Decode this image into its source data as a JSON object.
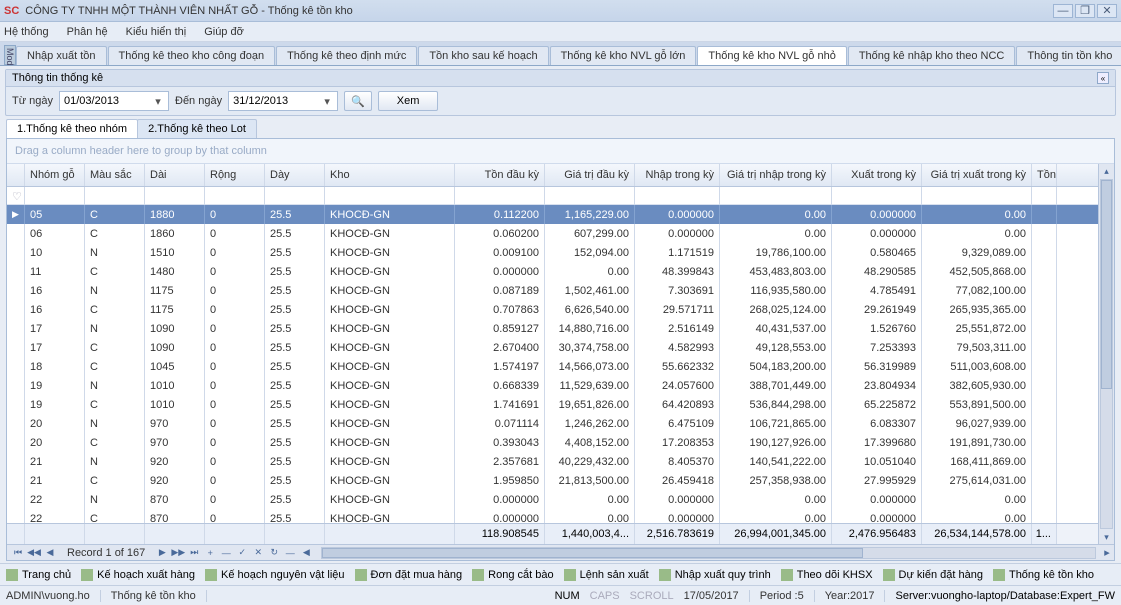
{
  "window": {
    "logo": "SC",
    "title": "CÔNG TY TNHH MỘT THÀNH VIÊN NHẤT GỖ - Thống kê tồn kho"
  },
  "menu": {
    "items": [
      "Hệ thống",
      "Phân hệ",
      "Kiểu hiển thị",
      "Giúp đỡ"
    ]
  },
  "sidebar_tab": "Modules",
  "tabs": {
    "items": [
      "Nhập xuất tồn",
      "Thống kê theo kho công đoạn",
      "Thống kê theo định mức",
      "Tồn kho sau kế hoạch",
      "Thống kê kho NVL gỗ lớn",
      "Thống kê kho NVL gỗ nhỏ",
      "Thống kê nhập kho theo NCC",
      "Thông tin tồn kho"
    ],
    "active": 5
  },
  "filter": {
    "group_title": "Thông tin thống kê",
    "collapse_glyph": "«",
    "from_label": "Từ ngày",
    "from_value": "01/03/2013",
    "to_label": "Đến ngày",
    "to_value": "31/12/2013",
    "search_icon": "🔍",
    "xem": "Xem"
  },
  "subtabs": {
    "items": [
      "1.Thống kê theo nhóm",
      "2.Thống kê theo Lot"
    ],
    "active": 0
  },
  "grid": {
    "group_hint": "Drag a column header here to group by that column",
    "funnel": "♡",
    "columns": [
      "Nhóm gỗ",
      "Màu sắc",
      "Dài",
      "Rộng",
      "Dày",
      "Kho",
      "Tồn đầu kỳ",
      "Giá trị đầu kỳ",
      "Nhập trong kỳ",
      "Giá trị nhập trong kỳ",
      "Xuất trong kỳ",
      "Giá trị xuất trong kỳ",
      "Tồn c"
    ],
    "rows": [
      {
        "sel": true,
        "nhom": "05",
        "mau": "C",
        "dai": "1880",
        "rong": "0",
        "day": "25.5",
        "kho": "KHOCĐ-GN",
        "tondk": "0.112200",
        "gtdk": "1,165,229.00",
        "nhaptk": "0.000000",
        "gtntk": "0.00",
        "xuattk": "0.000000",
        "gtxtk": "0.00"
      },
      {
        "nhom": "06",
        "mau": "C",
        "dai": "1860",
        "rong": "0",
        "day": "25.5",
        "kho": "KHOCĐ-GN",
        "tondk": "0.060200",
        "gtdk": "607,299.00",
        "nhaptk": "0.000000",
        "gtntk": "0.00",
        "xuattk": "0.000000",
        "gtxtk": "0.00"
      },
      {
        "nhom": "10",
        "mau": "N",
        "dai": "1510",
        "rong": "0",
        "day": "25.5",
        "kho": "KHOCĐ-GN",
        "tondk": "0.009100",
        "gtdk": "152,094.00",
        "nhaptk": "1.171519",
        "gtntk": "19,786,100.00",
        "xuattk": "0.580465",
        "gtxtk": "9,329,089.00"
      },
      {
        "nhom": "11",
        "mau": "C",
        "dai": "1480",
        "rong": "0",
        "day": "25.5",
        "kho": "KHOCĐ-GN",
        "tondk": "0.000000",
        "gtdk": "0.00",
        "nhaptk": "48.399843",
        "gtntk": "453,483,803.00",
        "xuattk": "48.290585",
        "gtxtk": "452,505,868.00"
      },
      {
        "nhom": "16",
        "mau": "N",
        "dai": "1175",
        "rong": "0",
        "day": "25.5",
        "kho": "KHOCĐ-GN",
        "tondk": "0.087189",
        "gtdk": "1,502,461.00",
        "nhaptk": "7.303691",
        "gtntk": "116,935,580.00",
        "xuattk": "4.785491",
        "gtxtk": "77,082,100.00"
      },
      {
        "nhom": "16",
        "mau": "C",
        "dai": "1175",
        "rong": "0",
        "day": "25.5",
        "kho": "KHOCĐ-GN",
        "tondk": "0.707863",
        "gtdk": "6,626,540.00",
        "nhaptk": "29.571711",
        "gtntk": "268,025,124.00",
        "xuattk": "29.261949",
        "gtxtk": "265,935,365.00"
      },
      {
        "nhom": "17",
        "mau": "N",
        "dai": "1090",
        "rong": "0",
        "day": "25.5",
        "kho": "KHOCĐ-GN",
        "tondk": "0.859127",
        "gtdk": "14,880,716.00",
        "nhaptk": "2.516149",
        "gtntk": "40,431,537.00",
        "xuattk": "1.526760",
        "gtxtk": "25,551,872.00"
      },
      {
        "nhom": "17",
        "mau": "C",
        "dai": "1090",
        "rong": "0",
        "day": "25.5",
        "kho": "KHOCĐ-GN",
        "tondk": "2.670400",
        "gtdk": "30,374,758.00",
        "nhaptk": "4.582993",
        "gtntk": "49,128,553.00",
        "xuattk": "7.253393",
        "gtxtk": "79,503,311.00"
      },
      {
        "nhom": "18",
        "mau": "C",
        "dai": "1045",
        "rong": "0",
        "day": "25.5",
        "kho": "KHOCĐ-GN",
        "tondk": "1.574197",
        "gtdk": "14,566,073.00",
        "nhaptk": "55.662332",
        "gtntk": "504,183,200.00",
        "xuattk": "56.319989",
        "gtxtk": "511,003,608.00"
      },
      {
        "nhom": "19",
        "mau": "N",
        "dai": "1010",
        "rong": "0",
        "day": "25.5",
        "kho": "KHOCĐ-GN",
        "tondk": "0.668339",
        "gtdk": "11,529,639.00",
        "nhaptk": "24.057600",
        "gtntk": "388,701,449.00",
        "xuattk": "23.804934",
        "gtxtk": "382,605,930.00"
      },
      {
        "nhom": "19",
        "mau": "C",
        "dai": "1010",
        "rong": "0",
        "day": "25.5",
        "kho": "KHOCĐ-GN",
        "tondk": "1.741691",
        "gtdk": "19,651,826.00",
        "nhaptk": "64.420893",
        "gtntk": "536,844,298.00",
        "xuattk": "65.225872",
        "gtxtk": "553,891,500.00"
      },
      {
        "nhom": "20",
        "mau": "N",
        "dai": "970",
        "rong": "0",
        "day": "25.5",
        "kho": "KHOCĐ-GN",
        "tondk": "0.071114",
        "gtdk": "1,246,262.00",
        "nhaptk": "6.475109",
        "gtntk": "106,721,865.00",
        "xuattk": "6.083307",
        "gtxtk": "96,027,939.00"
      },
      {
        "nhom": "20",
        "mau": "C",
        "dai": "970",
        "rong": "0",
        "day": "25.5",
        "kho": "KHOCĐ-GN",
        "tondk": "0.393043",
        "gtdk": "4,408,152.00",
        "nhaptk": "17.208353",
        "gtntk": "190,127,926.00",
        "xuattk": "17.399680",
        "gtxtk": "191,891,730.00"
      },
      {
        "nhom": "21",
        "mau": "N",
        "dai": "920",
        "rong": "0",
        "day": "25.5",
        "kho": "KHOCĐ-GN",
        "tondk": "2.357681",
        "gtdk": "40,229,432.00",
        "nhaptk": "8.405370",
        "gtntk": "140,541,222.00",
        "xuattk": "10.051040",
        "gtxtk": "168,411,869.00"
      },
      {
        "nhom": "21",
        "mau": "C",
        "dai": "920",
        "rong": "0",
        "day": "25.5",
        "kho": "KHOCĐ-GN",
        "tondk": "1.959850",
        "gtdk": "21,813,500.00",
        "nhaptk": "26.459418",
        "gtntk": "257,358,938.00",
        "xuattk": "27.995929",
        "gtxtk": "275,614,031.00"
      },
      {
        "nhom": "22",
        "mau": "N",
        "dai": "870",
        "rong": "0",
        "day": "25.5",
        "kho": "KHOCĐ-GN",
        "tondk": "0.000000",
        "gtdk": "0.00",
        "nhaptk": "0.000000",
        "gtntk": "0.00",
        "xuattk": "0.000000",
        "gtxtk": "0.00"
      },
      {
        "nhom": "22",
        "mau": "C",
        "dai": "870",
        "rong": "0",
        "day": "25.5",
        "kho": "KHOCĐ-GN",
        "tondk": "0.000000",
        "gtdk": "0.00",
        "nhaptk": "0.000000",
        "gtntk": "0.00",
        "xuattk": "0.000000",
        "gtxtk": "0.00"
      }
    ],
    "totals": {
      "tondk": "118.908545",
      "gtdk": "1,440,003,4...",
      "nhaptk": "2,516.783619",
      "gtntk": "26,994,001,345.00",
      "xuattk": "2,476.956483",
      "gtxtk": "26,534,144,578.00",
      "ton": "1..."
    },
    "record_text": "Record 1 of 167"
  },
  "bottom_nav": {
    "items": [
      "Trang chủ",
      "Kế hoạch xuất hàng",
      "Kế hoạch nguyên vật liệu",
      "Đơn đặt mua hàng",
      "Rong cắt bào",
      "Lệnh sản xuất",
      "Nhập xuất quy trình",
      "Theo dõi KHSX",
      "Dự kiến đặt hàng",
      "Thống kê tồn kho"
    ]
  },
  "status": {
    "user": "ADMIN\\vuong.ho",
    "screen": "Thống kê tồn kho",
    "num": "NUM",
    "caps": "CAPS",
    "scroll": "SCROLL",
    "date": "17/05/2017",
    "period": "Period :5",
    "year": "Year:2017",
    "server": "Server:vuongho-laptop/Database:Expert_FW"
  }
}
